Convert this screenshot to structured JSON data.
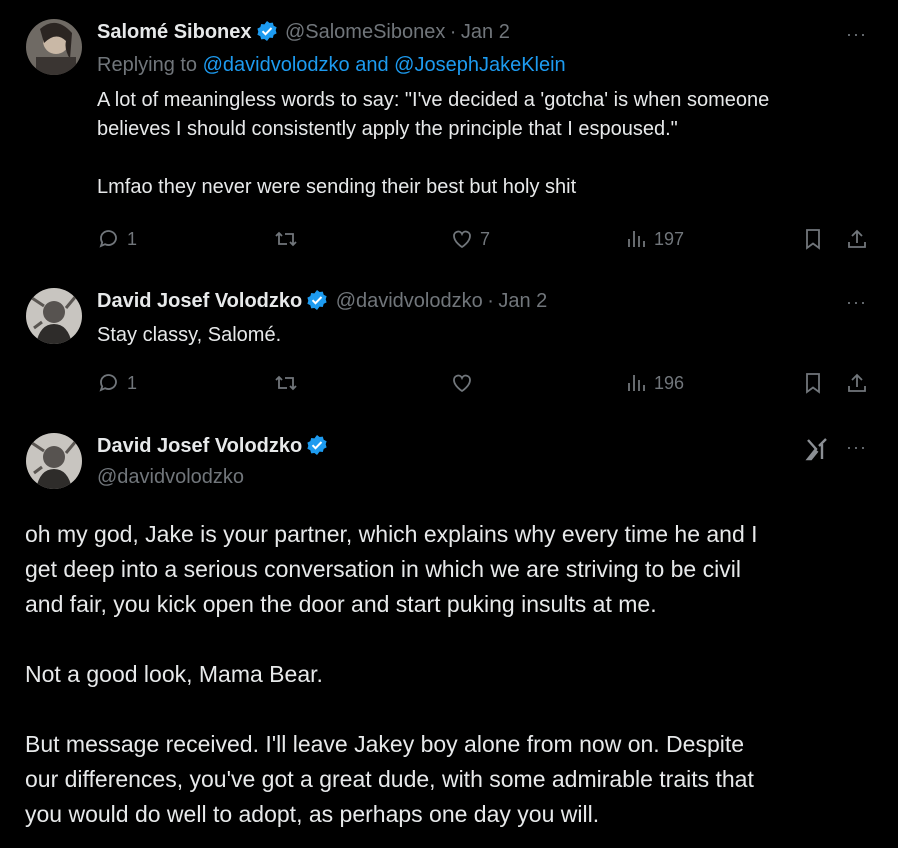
{
  "tweet1": {
    "name": "Salomé Sibonex",
    "handle": "@SalomeSibonex",
    "sep": "·",
    "date": "Jan 2",
    "replying_prefix": "Replying to",
    "replying_targets": "@davidvolodzko and @JosephJakeKlein",
    "text_lines": [
      "A lot of meaningless words to say: \"I've decided a 'gotcha' is when someone",
      "believes I should consistently apply the principle that I espoused.\"",
      "",
      "Lmfao they never were sending their best but holy shit"
    ],
    "replies": "1",
    "retweets": "",
    "likes": "7",
    "views": "197",
    "more": "···"
  },
  "tweet2": {
    "name": "David Josef Volodzko",
    "handle": "@davidvolodzko",
    "sep": "·",
    "date": "Jan 2",
    "text": "Stay classy, Salomé.",
    "replies": "1",
    "retweets": "",
    "likes": "",
    "views": "196",
    "more": "···"
  },
  "tweet3": {
    "name": "David Josef Volodzko",
    "handle": "@davidvolodzko",
    "more": "···",
    "paragraphs": [
      [
        "oh my god, Jake is your partner, which explains why every time he and I",
        "get deep into a serious conversation in which we are striving to be civil",
        "and fair, you kick open the door and start puking insults at me."
      ],
      [
        "Not a good look, Mama Bear."
      ],
      [
        "But message received. I'll leave Jakey boy alone from now on. Despite",
        "our differences, you've got a great dude, with some admirable traits that",
        "you would do well to adopt, as perhaps one day you will."
      ]
    ]
  },
  "colors": {
    "background": "#000000",
    "text": "#e7e9ea",
    "muted": "#71767b",
    "link": "#1d9bf0",
    "verified": "#1d9bf0"
  }
}
